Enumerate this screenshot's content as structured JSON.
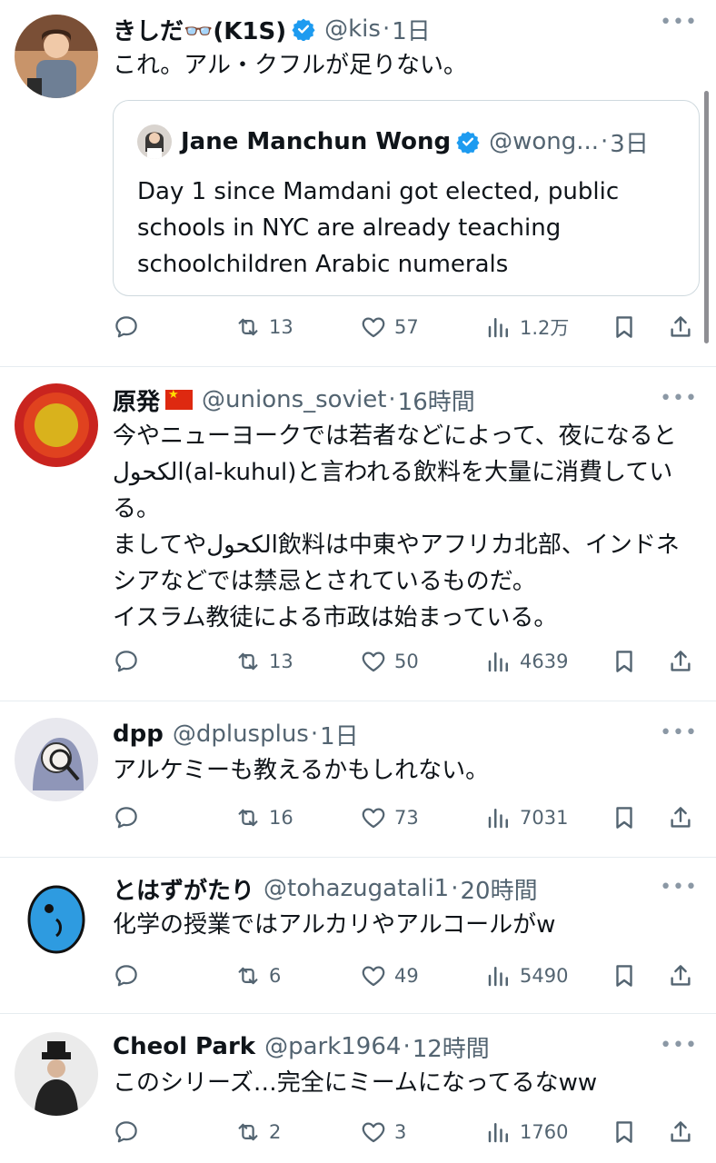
{
  "tweets": [
    {
      "name": "きしだ👓(K1S)",
      "handle": "@kis",
      "sep": "·",
      "time": "1日",
      "verified": true,
      "text": "これ。アル・クフルが足りない。",
      "quote": {
        "name": "Jane Manchun Wong",
        "handle": "@wong...",
        "sep": "·",
        "time": "3日",
        "text": "Day 1 since Mamdani got elected, public schools in NYC are already teaching schoolchildren Arabic numerals"
      },
      "stats": {
        "reply": "",
        "retweet": "13",
        "like": "57",
        "views": "1.2万"
      }
    },
    {
      "name": "原発",
      "handle": "@unions_soviet",
      "sep": "·",
      "time": "16時間",
      "text": "今やニューヨークでは若者などによって、夜になるとالكحول(al-kuhul)と言われる飲料を大量に消費している。\nましてやالكحول飲料は中東やアフリカ北部、インドネシアなどでは禁忌とされているものだ。\nイスラム教徒による市政は始まっている。",
      "stats": {
        "reply": "",
        "retweet": "13",
        "like": "50",
        "views": "4639"
      }
    },
    {
      "name": "dpp",
      "handle": "@dplusplus",
      "sep": "·",
      "time": "1日",
      "text": "アルケミーも教えるかもしれない。",
      "stats": {
        "reply": "",
        "retweet": "16",
        "like": "73",
        "views": "7031"
      }
    },
    {
      "name": "とはずがたり",
      "handle": "@tohazugatali1",
      "sep": "·",
      "time": "20時間",
      "text": "化学の授業ではアルカリやアルコールがw",
      "stats": {
        "reply": "",
        "retweet": "6",
        "like": "49",
        "views": "5490"
      }
    },
    {
      "name": "Cheol Park",
      "handle": "@park1964",
      "sep": "·",
      "time": "12時間",
      "text": "このシリーズ…完全にミームになってるなww",
      "stats": {
        "reply": "",
        "retweet": "2",
        "like": "3",
        "views": "1760"
      }
    }
  ],
  "more_label": "•••",
  "colors": {
    "verified": "#1d9bf0",
    "muted": "#536471",
    "flag": "#de2910"
  },
  "icons": [
    "reply-icon",
    "retweet-icon",
    "like-icon",
    "views-icon",
    "bookmark-icon",
    "share-icon",
    "verified-badge-icon",
    "more-icon"
  ]
}
